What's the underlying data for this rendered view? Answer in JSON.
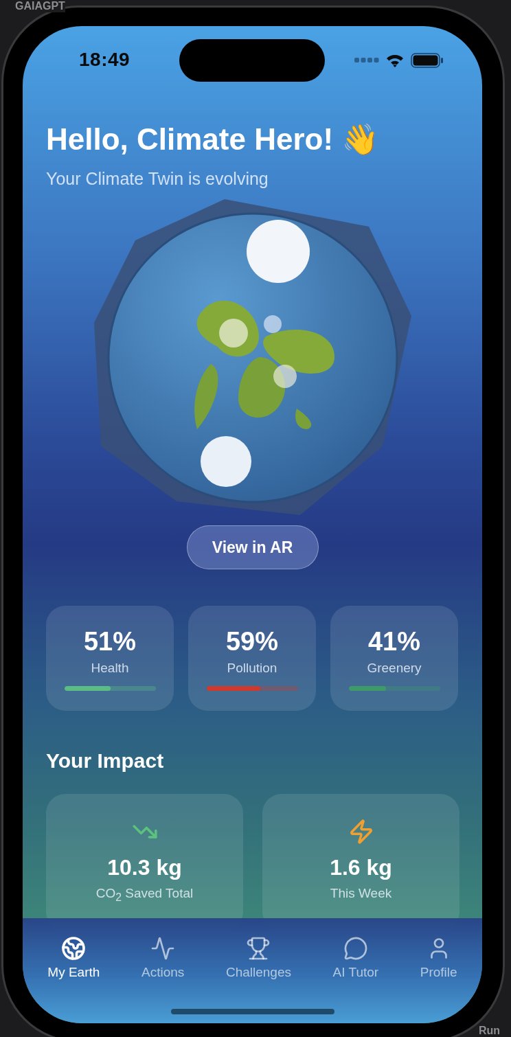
{
  "background": {
    "top_label": "GAIAGPT",
    "bottom_label": "Run"
  },
  "status_bar": {
    "time": "18:49"
  },
  "header": {
    "title": "Hello, Climate Hero! 👋",
    "subtitle": "Your Climate Twin is evolving"
  },
  "ar_button": "View in AR",
  "stats": [
    {
      "value": "51%",
      "label": "Health",
      "level": 0.51,
      "color": "#5bbd85"
    },
    {
      "value": "59%",
      "label": "Pollution",
      "level": 0.59,
      "color": "#d0392e"
    },
    {
      "value": "41%",
      "label": "Greenery",
      "level": 0.41,
      "color": "#3f9a6a"
    }
  ],
  "impact": {
    "title": "Your Impact",
    "cards": [
      {
        "value": "10.3 kg",
        "label": "CO$_{2}$ Saved Total"
      },
      {
        "value": "1.6 kg",
        "label": "This Week"
      }
    ]
  },
  "tabs": [
    {
      "label": "My Earth",
      "selected": true
    },
    {
      "label": "Actions",
      "selected": false
    },
    {
      "label": "Challenges",
      "selected": false
    },
    {
      "label": "AI Tutor",
      "selected": false
    },
    {
      "label": "Profile",
      "selected": false
    }
  ]
}
